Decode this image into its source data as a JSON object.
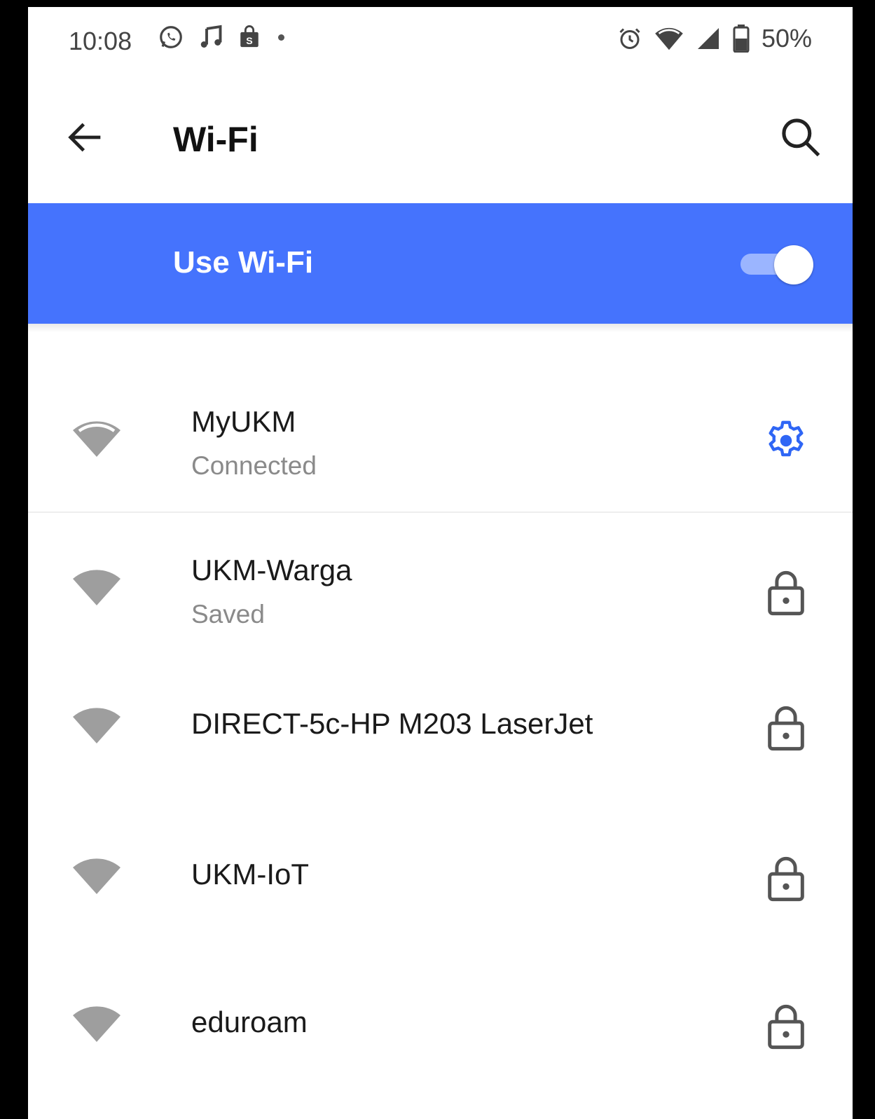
{
  "status_bar": {
    "time": "10:08",
    "battery": "50%",
    "left_icons": [
      "whatsapp-icon",
      "music-note-icon",
      "shopping-bag-icon",
      "notification-dot"
    ],
    "right_icons": [
      "alarm-icon",
      "wifi-status-icon",
      "cell-signal-icon",
      "battery-icon"
    ]
  },
  "app_bar": {
    "title": "Wi-Fi",
    "back_icon": "arrow-left-icon",
    "search_icon": "search-icon"
  },
  "master_toggle": {
    "label": "Use Wi-Fi",
    "enabled": true
  },
  "colors": {
    "accent": "#4573fd",
    "icon_grey": "#9e9e9e",
    "gear": "#2f66f5"
  },
  "networks": [
    {
      "name": "MyUKM",
      "status": "Connected",
      "trailing_icon": "gear-icon"
    },
    {
      "name": "UKM-Warga",
      "status": "Saved",
      "trailing_icon": "lock-icon"
    },
    {
      "name": "DIRECT-5c-HP M203 LaserJet",
      "status": "",
      "trailing_icon": "lock-icon"
    },
    {
      "name": "UKM-IoT",
      "status": "",
      "trailing_icon": "lock-icon"
    },
    {
      "name": "eduroam",
      "status": "",
      "trailing_icon": "lock-icon"
    }
  ]
}
